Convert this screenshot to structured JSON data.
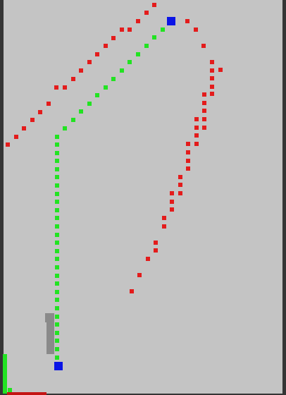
{
  "colors": {
    "background": "#c4c4c4",
    "frame": "#353535",
    "trail_red": "#e31c1c",
    "trail_green": "#22e322",
    "marker": "#0a14e6",
    "obstacle": "#8a8a8a",
    "gauge_green": "#22e322",
    "gauge_red": "#c41414"
  },
  "gauges": {
    "vertical_level": 1.0,
    "horizontal_level": 1.0
  }
}
